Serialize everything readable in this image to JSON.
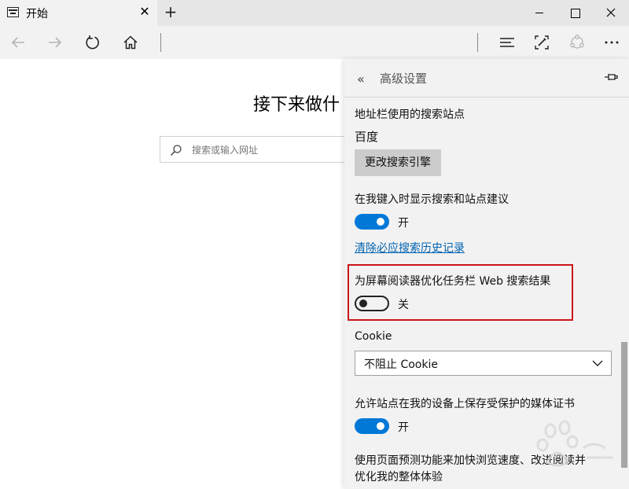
{
  "tab": {
    "title": "开始",
    "close": "✕"
  },
  "new_tab": "+",
  "page": {
    "heading": "接下来做什",
    "search_placeholder": "搜索或输入网址"
  },
  "panel": {
    "back": "«",
    "title": "高级设置",
    "address_bar_search_label": "地址栏使用的搜索站点",
    "search_engine_value": "百度",
    "change_engine_button": "更改搜索引擎",
    "show_suggestions_label": "在我键入时显示搜索和站点建议",
    "show_suggestions_state": "开",
    "clear_history_link": "清除必应搜索历史记录",
    "screen_reader_label": "为屏幕阅读器优化任务栏 Web 搜索结果",
    "screen_reader_state": "关",
    "cookie_label": "Cookie",
    "cookie_value": "不阻止 Cookie",
    "media_license_label": "允许站点在我的设备上保存受保护的媒体证书",
    "media_license_state": "开",
    "page_prediction_line1": "使用页面预测功能来加快浏览速度、改进阅读并",
    "page_prediction_line2": "优化我的整体体验"
  },
  "colors": {
    "accent": "#0078d7",
    "link": "#0063b1",
    "highlight_border": "#c9161b",
    "panel_background": "#f2f2f2"
  },
  "icons": [
    "browser-page-icon",
    "back-arrow-icon",
    "forward-arrow-icon",
    "refresh-icon",
    "home-icon",
    "hub-icon",
    "web-note-icon",
    "share-icon",
    "more-icon",
    "search-icon",
    "pin-icon",
    "chevron-down-icon"
  ]
}
